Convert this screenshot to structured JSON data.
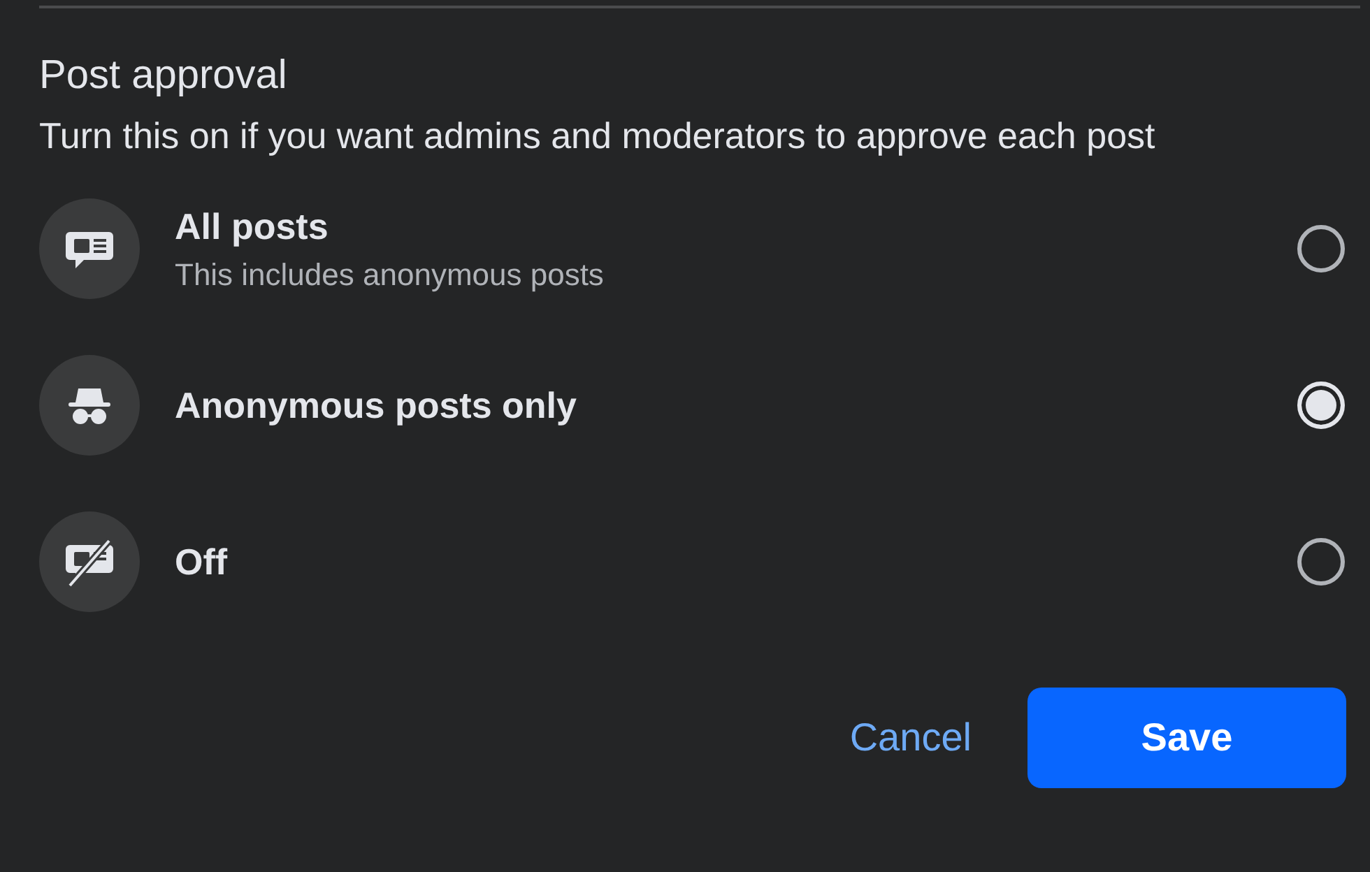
{
  "section": {
    "title": "Post approval",
    "description": "Turn this on if you want admins and moderators to approve each post"
  },
  "options": [
    {
      "kind": "comment",
      "label": "All posts",
      "sublabel": "This includes anonymous posts",
      "selected": false
    },
    {
      "kind": "incognito",
      "label": "Anonymous posts only",
      "selected": true
    },
    {
      "kind": "comment-off",
      "label": "Off",
      "selected": false
    }
  ],
  "buttons": {
    "cancel": "Cancel",
    "save": "Save"
  }
}
